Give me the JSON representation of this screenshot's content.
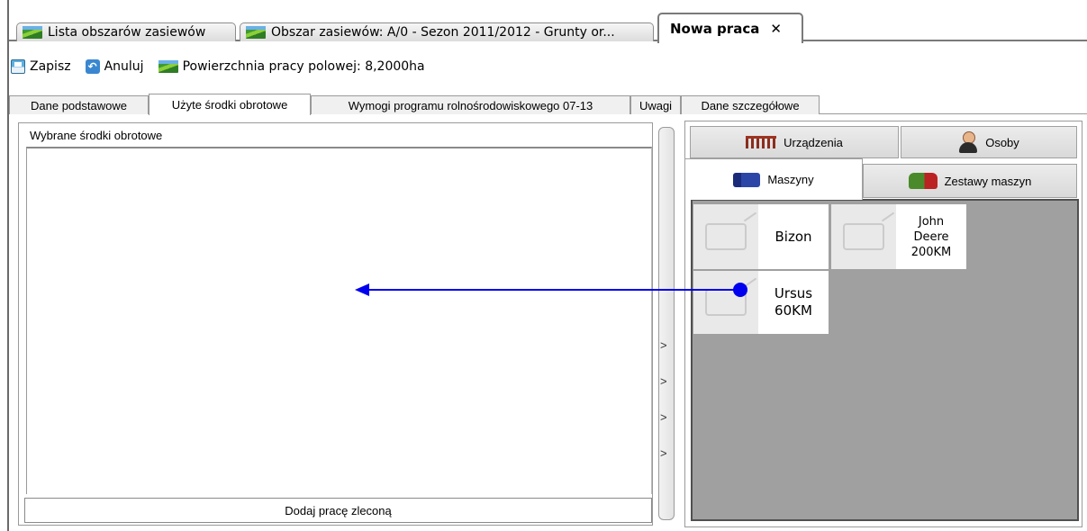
{
  "document_tabs": [
    {
      "label": "Lista obszarów zasiewów",
      "icon": "field-icon"
    },
    {
      "label": "Obszar zasiewów: A/0 - Sezon 2011/2012 - Grunty or...",
      "icon": "field-icon"
    },
    {
      "label": "Nowa praca",
      "close": "✕",
      "active": true
    }
  ],
  "toolbar": {
    "save_label": "Zapisz",
    "cancel_label": "Anuluj",
    "area_label": "Powierzchnia pracy polowej: 8,2000ha"
  },
  "inner_tabs": [
    {
      "label": "Dane podstawowe"
    },
    {
      "label": "Użyte środki obrotowe",
      "active": true
    },
    {
      "label": "Wymogi programu rolnośrodowiskowego 07-13"
    },
    {
      "label": "Uwagi"
    },
    {
      "label": "Dane szczegółowe"
    }
  ],
  "left_panel": {
    "title": "Wybrane środki obrotowe",
    "button_label": "Dodaj pracę zleconą"
  },
  "splitter": {
    "chevrons": [
      ">",
      ">",
      ">",
      ">"
    ]
  },
  "right_panel": {
    "tabs_row1": [
      {
        "label": "Urządzenia",
        "icon": "harrow-icon"
      },
      {
        "label": "Osoby",
        "icon": "person-icon"
      }
    ],
    "tabs_row2": [
      {
        "label": "Maszyny",
        "icon": "combine-icon",
        "active": true
      },
      {
        "label": "Zestawy maszyn",
        "icon": "tractor-icon"
      }
    ],
    "machines": [
      {
        "name": "Bizon"
      },
      {
        "name": "John\nDeere\n200KM"
      },
      {
        "name": "Ursus\n60KM"
      }
    ]
  },
  "colors": {
    "drag_arrow": "#0000ee",
    "machine_area_bg": "#a0a0a0"
  }
}
